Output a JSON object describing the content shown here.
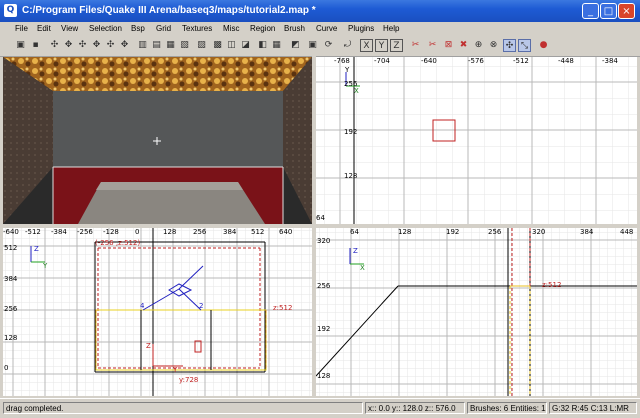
{
  "window": {
    "title": "C:/Program Files/Quake III Arena/baseq3/maps/tutorial2.map *"
  },
  "menu": [
    "File",
    "Edit",
    "View",
    "Selection",
    "Bsp",
    "Grid",
    "Textures",
    "Misc",
    "Region",
    "Brush",
    "Curve",
    "Plugins",
    "Help"
  ],
  "toolbar_axis_buttons": [
    "X",
    "Y",
    "Z"
  ],
  "views": {
    "top_right": {
      "x_ticks": [
        "-768",
        "-704",
        "-640",
        "-576",
        "-512",
        "-448",
        "-384"
      ],
      "y_ticks": [
        "256",
        "192",
        "128",
        "64"
      ],
      "axis_labels": [
        "Y",
        "X"
      ]
    },
    "bottom_left": {
      "x_ticks": [
        "-640",
        "-512",
        "-384",
        "-256",
        "-128",
        "0",
        "128",
        "256",
        "384",
        "512",
        "640"
      ],
      "y_ticks": [
        "512",
        "384",
        "256",
        "128",
        "0"
      ],
      "axis_labels": [
        "Z",
        "Y"
      ],
      "size_top": "(-256 ,z:512)",
      "size_right": "z:512",
      "size_bottom": "y:728",
      "marker_labels": [
        "4",
        "2",
        "Z",
        "Y"
      ]
    },
    "bottom_right": {
      "x_ticks": [
        "64",
        "128",
        "192",
        "256",
        "320",
        "384",
        "448"
      ],
      "y_ticks": [
        "320",
        "256",
        "192",
        "128"
      ],
      "axis_labels": [
        "Z",
        "X"
      ],
      "size_label": "z:512"
    }
  },
  "status": {
    "message": "drag completed.",
    "coords": "x:: 0.0  y:: 128.0  z:: 576.0",
    "counts": "Brushes: 6 Entities: 1",
    "grid": "G:32 R:45 C:13 L:MR"
  }
}
